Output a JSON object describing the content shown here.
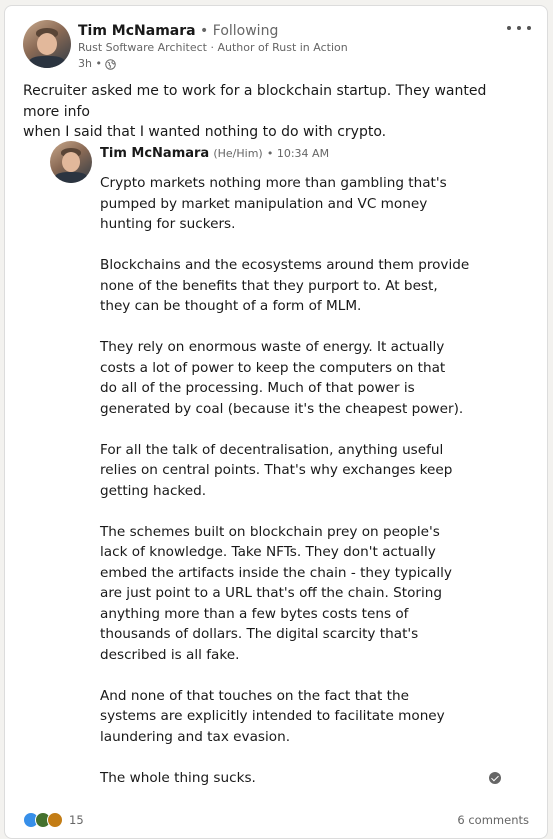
{
  "author": {
    "name": "Tim McNamara",
    "separator": "•",
    "follow_status": "Following",
    "headline": "Rust Software Architect · Author of Rust in Action",
    "timestamp": "3h •",
    "visibility_icon": "globe-icon"
  },
  "commentary": "Recruiter asked me to work for a blockchain startup. They wanted more info\nwhen I said that I wanted nothing to do with crypto.",
  "embedded": {
    "name": "Tim McNamara",
    "pronouns": "(He/Him)",
    "time": "• 10:34 AM",
    "paragraphs": [
      "Crypto markets nothing more than gambling that's\npumped by market manipulation and VC money\nhunting for suckers.",
      "Blockchains and the ecosystems around them provide\nnone of the benefits that they purport to. At best,\nthey can be thought of a form of MLM.",
      "They rely on enormous waste of energy. It actually\ncosts a lot of power to keep the computers on that\ndo all of the processing. Much of that power is\ngenerated by coal (because it's the cheapest power).",
      "For all the talk of decentralisation, anything useful\nrelies on central points. That's why exchanges keep\ngetting hacked.",
      "The schemes built on blockchain prey on people's\nlack of knowledge. Take NFTs. They don't actually\nembed the artifacts inside the chain - they typically\nare just point to a URL that's off the chain. Storing\nanything more than a few bytes costs tens of\nthousands of dollars. The digital scarcity that's\ndescribed is all fake.",
      "And none of that touches on the fact that the\nsystems are explicitly intended to facilitate money\nlaundering and tax evasion.",
      "The whole thing sucks."
    ]
  },
  "social": {
    "reaction_icons": [
      "like-icon",
      "celebrate-icon",
      "insightful-icon"
    ],
    "reaction_count": "15",
    "comments": "6 comments"
  },
  "colors": {
    "like": "#378fe9",
    "celebrate": "#44712e",
    "insightful": "#c37d16",
    "secondary_text": "#666666"
  }
}
